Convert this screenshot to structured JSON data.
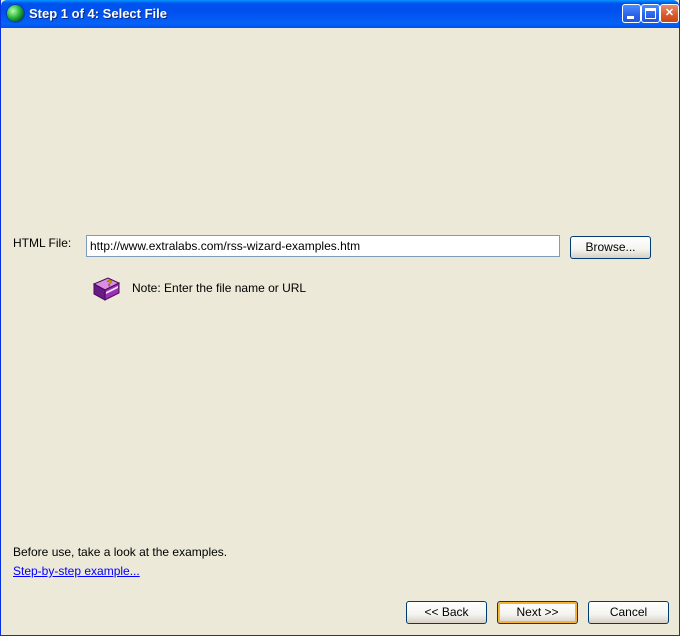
{
  "window": {
    "title": "Step 1 of 4: Select File",
    "accent": "#0054E3",
    "icons": {
      "app": "globe-icon",
      "minimize": "minimize-icon",
      "maximize": "maximize-icon",
      "close": "close-icon"
    },
    "close_glyph": "✕"
  },
  "form": {
    "html_file_label": "HTML File:",
    "html_file_value": "http://www.extralabs.com/rss-wizard-examples.htm",
    "browse_label": "Browse...",
    "note_icon": "help-book-icon",
    "note_text": "Note: Enter the file name or URL"
  },
  "footer": {
    "hint_text": "Before use, take a look at the examples.",
    "example_link": "Step-by-step example...",
    "back_label": "<< Back",
    "next_label": "Next >>",
    "cancel_label": "Cancel"
  }
}
